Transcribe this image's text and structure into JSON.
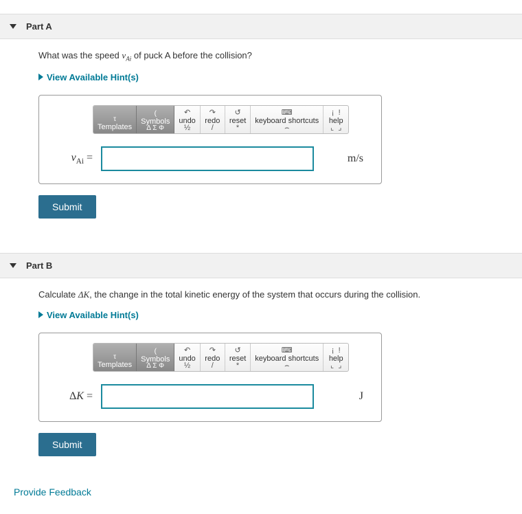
{
  "toolbar": {
    "templates": "Templates",
    "symbols": "Symbols",
    "undo": "undo",
    "redo": "redo",
    "reset": "reset",
    "keyboard": "keyboard shortcuts",
    "help": "help"
  },
  "partA": {
    "title": "Part A",
    "question_pre": "What was the speed ",
    "question_var": "v_Ai",
    "question_post": " of puck A before the collision?",
    "hints": "View Available Hint(s)",
    "lhs": "v_Ai =",
    "value": "",
    "units": "m/s",
    "submit": "Submit"
  },
  "partB": {
    "title": "Part B",
    "question_pre": "Calculate ",
    "question_var": "ΔK",
    "question_post": ", the change in the total kinetic energy of the system that occurs during the collision.",
    "hints": "View Available Hint(s)",
    "lhs": "ΔK =",
    "value": "",
    "units": "J",
    "submit": "Submit"
  },
  "feedback": "Provide Feedback"
}
